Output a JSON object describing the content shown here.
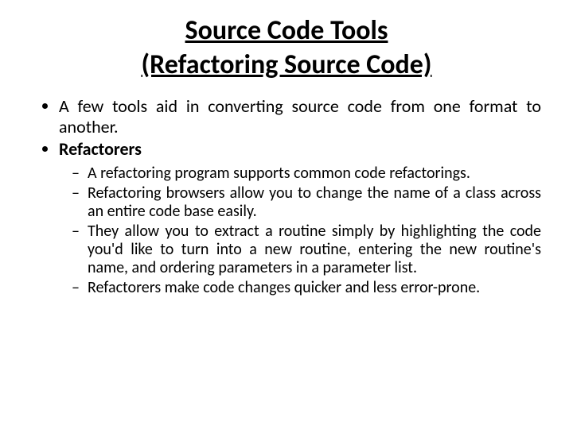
{
  "title_line1": "Source Code Tools",
  "title_line2": "(Refactoring Source Code)",
  "bullets": {
    "b1": "A few tools aid in converting source code from one format to another.",
    "b2": "Refactorers",
    "sub": {
      "s1": "A refactoring program supports common code refactorings.",
      "s2": "Refactoring browsers allow you to change the name of a class across an entire code base easily.",
      "s3": "They allow you to extract a routine simply by highlighting the code you'd like to turn into a new routine, entering the new routine's name, and ordering parameters in a parameter list.",
      "s4": "Refactorers make code changes quicker and less error-prone."
    }
  }
}
